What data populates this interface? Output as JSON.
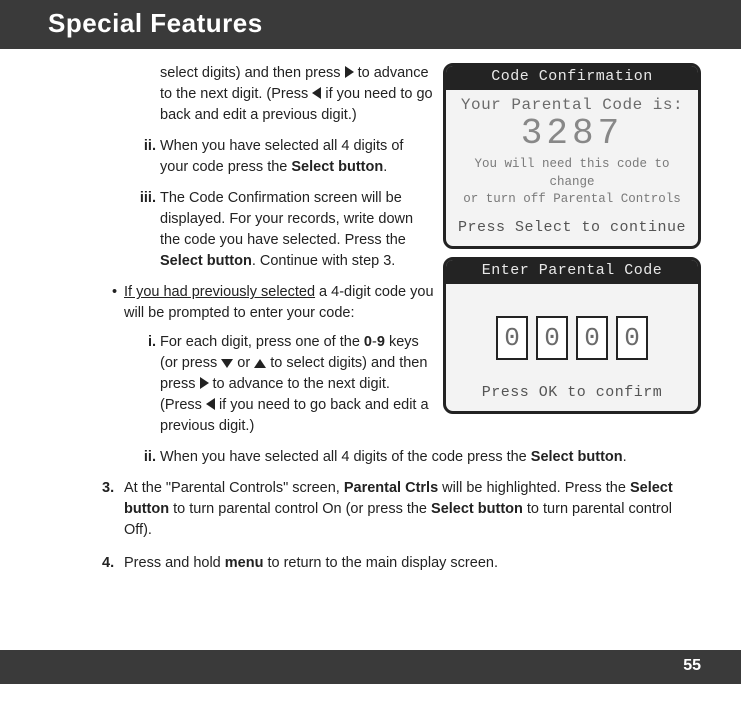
{
  "header": {
    "title": "Special Features"
  },
  "screens": {
    "confirm": {
      "title": "Code Confirmation",
      "line1": "Your Parental Code is:",
      "code": "3287",
      "note1": "You will need this code to change",
      "note2": "or turn off Parental Controls",
      "prompt": "Press Select to continue"
    },
    "enter": {
      "title": "Enter Parental Code",
      "digits": [
        "0",
        "0",
        "0",
        "0"
      ],
      "prompt": "Press OK to confirm"
    }
  },
  "text": {
    "frag1a": "select digits) and then press ",
    "frag1b": " to advance to the next digit. (Press ",
    "frag1c": " if you need to go back and edit a previous digit.)",
    "ii_a": "When you have selected all 4 digits of your code press the ",
    "ii_b": "Select button",
    "ii_c": ".",
    "iii_a": "The Code Confirmation screen will be displayed. For your records, write down the code you have selected. Press the ",
    "iii_b": "Select button",
    "iii_c": ". Continue with step 3.",
    "prev_a": "If you had previously selected",
    "prev_b": " a 4-digit code you will be prompted to enter your code:",
    "i2_a": "For each digit, press one of the ",
    "i2_b": "0",
    "i2_dash": "-",
    "i2_c": "9",
    "i2_d": " keys (or press ",
    "i2_e": " or ",
    "i2_f": " to select digits) and then press ",
    "i2_g": " to advance to the next digit. (Press ",
    "i2_h": " if you need to go back and edit a previous digit.)",
    "ii2_a": "When you have selected all 4 digits of the code press the ",
    "ii2_b": "Select button",
    "ii2_c": ".",
    "s3_a": "At the \"Parental Controls\" screen, ",
    "s3_b": "Parental Ctrls",
    "s3_c": " will be highlighted. Press the ",
    "s3_d": "Select button",
    "s3_e": " to turn parental control On (or press the ",
    "s3_f": "Select button",
    "s3_g": " to turn parental control Off).",
    "s4_a": "Press and hold ",
    "s4_b": "menu",
    "s4_c": " to return to the main display screen.",
    "rn_ii": "ii.",
    "rn_iii": "iii.",
    "rn_i": "i.",
    "nn_3": "3.",
    "nn_4": "4."
  },
  "footer": {
    "page": "55"
  }
}
